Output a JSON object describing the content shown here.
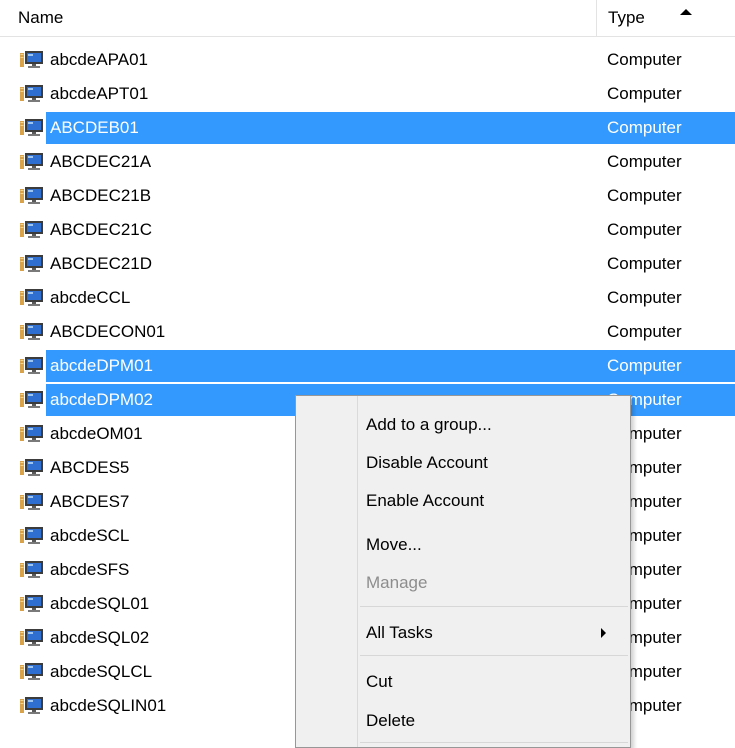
{
  "columns": {
    "name": "Name",
    "type": "Type",
    "sort": "ascending"
  },
  "icon": "computer-icon",
  "colors": {
    "selection": "#3399ff",
    "menu_background": "#f0f0f0",
    "disabled_text": "#8d8d8d"
  },
  "rows": [
    {
      "name": "abcdeAPA01",
      "type": "Computer",
      "selected": false
    },
    {
      "name": "abcdeAPT01",
      "type": "Computer",
      "selected": false
    },
    {
      "name": "ABCDEB01",
      "type": "Computer",
      "selected": true
    },
    {
      "name": "ABCDEC21A",
      "type": "Computer",
      "selected": false
    },
    {
      "name": "ABCDEC21B",
      "type": "Computer",
      "selected": false
    },
    {
      "name": "ABCDEC21C",
      "type": "Computer",
      "selected": false
    },
    {
      "name": "ABCDEC21D",
      "type": "Computer",
      "selected": false
    },
    {
      "name": "abcdeCCL",
      "type": "Computer",
      "selected": false
    },
    {
      "name": "ABCDECON01",
      "type": "Computer",
      "selected": false
    },
    {
      "name": "abcdeDPM01",
      "type": "Computer",
      "selected": true
    },
    {
      "name": "abcdeDPM02",
      "type": "Computer",
      "selected": true
    },
    {
      "name": "abcdeOM01",
      "type": "Computer",
      "selected": false
    },
    {
      "name": "ABCDES5",
      "type": "Computer",
      "selected": false
    },
    {
      "name": "ABCDES7",
      "type": "Computer",
      "selected": false
    },
    {
      "name": "abcdeSCL",
      "type": "Computer",
      "selected": false
    },
    {
      "name": "abcdeSFS",
      "type": "Computer",
      "selected": false
    },
    {
      "name": "abcdeSQL01",
      "type": "Computer",
      "selected": false
    },
    {
      "name": "abcdeSQL02",
      "type": "Computer",
      "selected": false
    },
    {
      "name": "abcdeSQLCL",
      "type": "Computer",
      "selected": false
    },
    {
      "name": "abcdeSQLIN01",
      "type": "Computer",
      "selected": false
    }
  ],
  "context_menu": {
    "items": [
      {
        "label": "Add to a group...",
        "enabled": true
      },
      {
        "label": "Disable Account",
        "enabled": true
      },
      {
        "label": "Enable Account",
        "enabled": true
      },
      {
        "label": "Move...",
        "enabled": true
      },
      {
        "label": "Manage",
        "enabled": false
      },
      {
        "label": "All Tasks",
        "enabled": true,
        "submenu": true
      },
      {
        "label": "Cut",
        "enabled": true
      },
      {
        "label": "Delete",
        "enabled": true
      }
    ]
  }
}
